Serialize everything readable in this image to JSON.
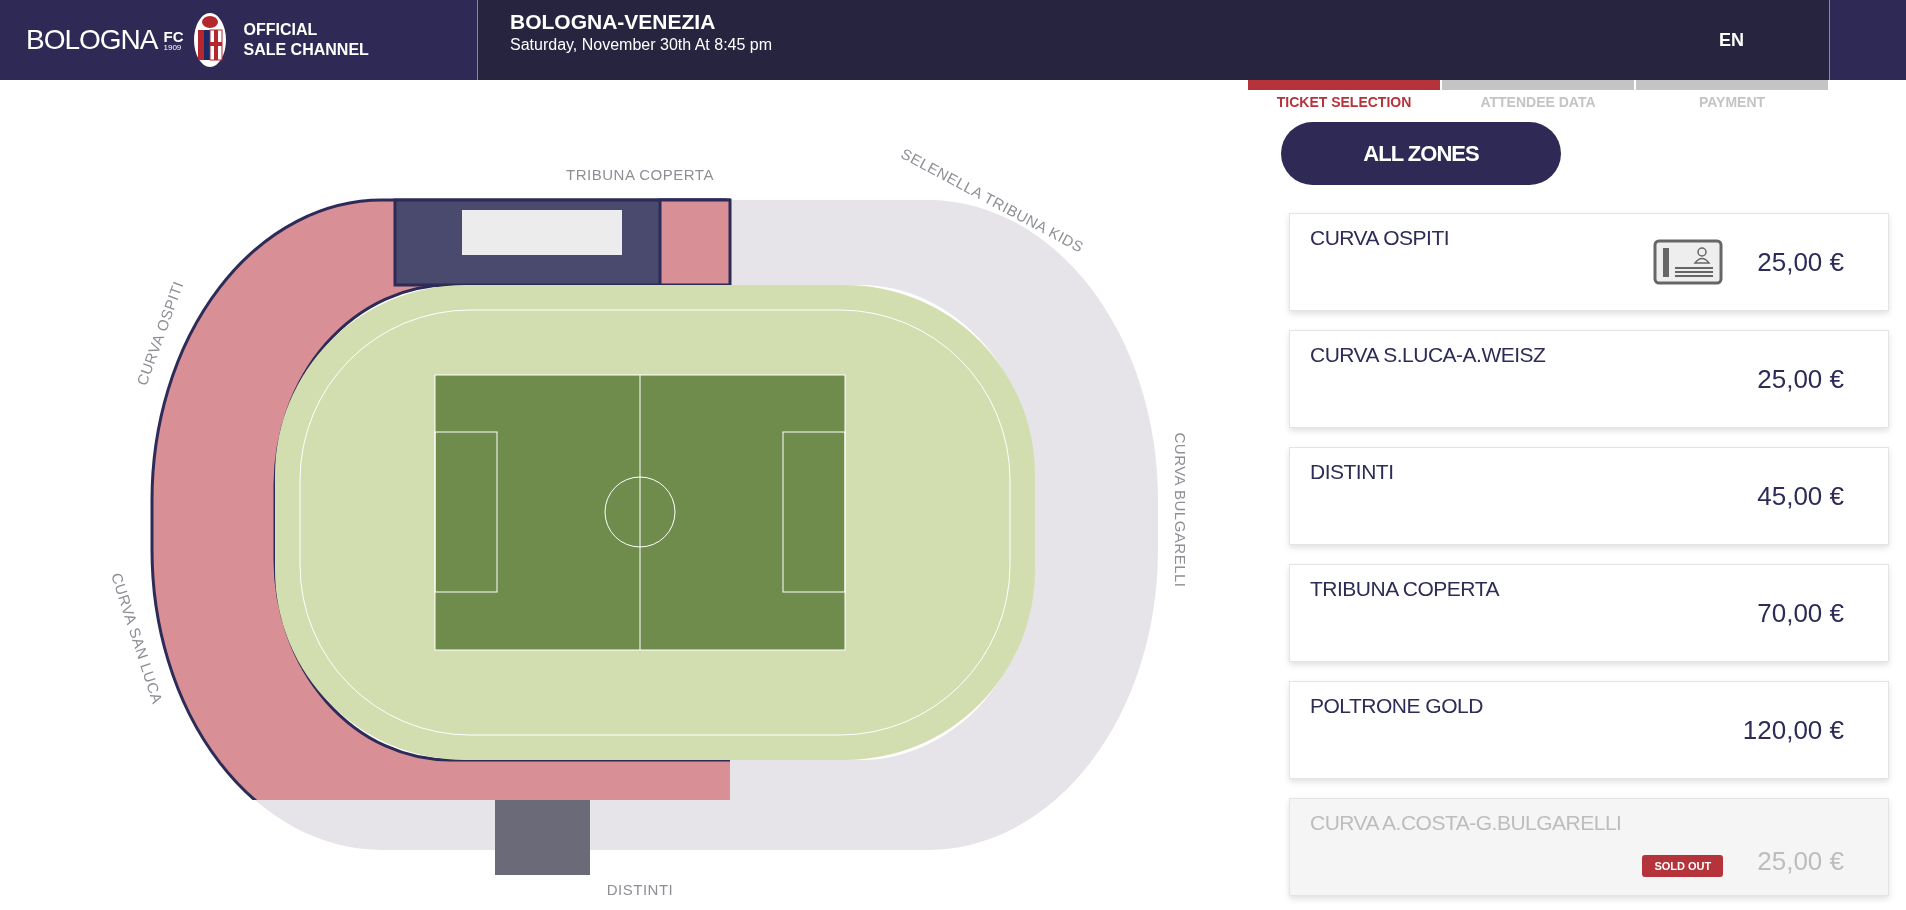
{
  "header": {
    "club_name": "BOLOGNA",
    "club_suffix": "FC",
    "club_year": "1909",
    "channel_lines": [
      "OFFICIAL",
      "SALE CHANNEL"
    ],
    "event_title": "BOLOGNA-VENEZIA",
    "event_date": "Saturday, November 30th At 8:45 pm",
    "language": "EN"
  },
  "steps": [
    {
      "label": "TICKET SELECTION",
      "selected": true
    },
    {
      "label": "ATTENDEE DATA",
      "selected": false
    },
    {
      "label": "PAYMENT",
      "selected": false
    }
  ],
  "all_zones_button": "ALL ZONES",
  "stadium_map": {
    "labels": [
      "TRIBUNA COPERTA",
      "SELENELLA TRIBUNA KIDS",
      "CURVA OSPITI",
      "CURVA BULGARELLI",
      "CURVA SAN LUCA",
      "DISTINTI"
    ]
  },
  "zones": [
    {
      "name": "CURVA OSPITI",
      "price": "25,00 €",
      "id_required": true,
      "sold_out": false
    },
    {
      "name": "CURVA S.LUCA-A.WEISZ",
      "price": "25,00 €",
      "id_required": false,
      "sold_out": false
    },
    {
      "name": "DISTINTI",
      "price": "45,00 €",
      "id_required": false,
      "sold_out": false
    },
    {
      "name": "TRIBUNA COPERTA",
      "price": "70,00 €",
      "id_required": false,
      "sold_out": false
    },
    {
      "name": "POLTRONE GOLD",
      "price": "120,00 €",
      "id_required": false,
      "sold_out": false
    },
    {
      "name": "CURVA A.COSTA-G.BULGARELLI",
      "price": "25,00 €",
      "id_required": false,
      "sold_out": true,
      "badge": "SOLD OUT"
    }
  ]
}
